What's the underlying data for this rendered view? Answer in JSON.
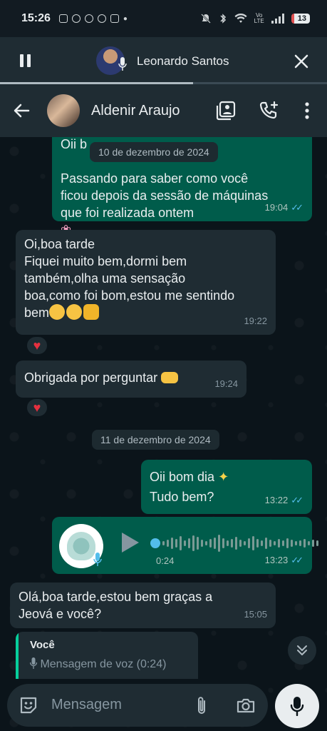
{
  "status_bar": {
    "time": "15:26",
    "battery": "13"
  },
  "call_banner": {
    "name": "Leonardo Santos",
    "progress": 0.59
  },
  "header": {
    "contact_name": "Aldenir Araujo"
  },
  "messages": {
    "m1_partial": "Oii b",
    "m1_text": "Passando para saber como você\nficou depois da sessão de máquinas\nque foi realizada ontem",
    "m1_time": "19:04",
    "date1": "10 de dezembro de 2024",
    "m2_text": "Oi,boa tarde\nFiquei muito bem,dormi bem\ntambém,olha uma sensação\nboa,como foi bom,estou me sentindo\nbem",
    "m2_time": "19:22",
    "m3_text": "Obrigada por perguntar",
    "m3_time": "19:24",
    "date2": "11 de dezembro de 2024",
    "m4_line1": "Oii bom dia",
    "m4_line2": "Tudo bem?",
    "m4_time": "13:22",
    "voice_duration": "0:24",
    "voice_time": "13:23",
    "m6_text": "Olá,boa tarde,estou bem graças a\nJeová e você?",
    "m6_time": "15:05"
  },
  "reply": {
    "author": "Você",
    "snippet": "Mensagem de voz (0:24)"
  },
  "composer": {
    "placeholder": "Mensagem"
  },
  "colors": {
    "outgoing": "#005c4b",
    "incoming": "#1f2c33",
    "read_ticks": "#53bdeb",
    "reaction_heart": "#e6303f"
  },
  "icons": [
    "back-arrow-icon",
    "pause-icon",
    "close-icon",
    "media-gallery-icon",
    "add-call-icon",
    "more-options-icon",
    "emoji-icon",
    "attach-icon",
    "camera-icon",
    "mic-icon",
    "scroll-down-icon",
    "heart-icon",
    "play-icon"
  ]
}
